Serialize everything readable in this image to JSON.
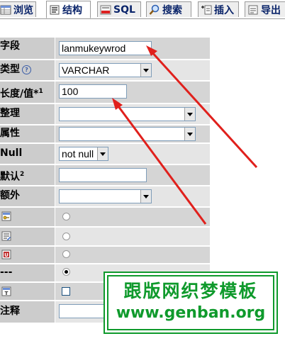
{
  "tabs": [
    {
      "label": "浏览",
      "icon": "browse-icon",
      "active": false
    },
    {
      "label": "结构",
      "icon": "structure-icon",
      "active": true
    },
    {
      "label": "SQL",
      "icon": "sql-icon",
      "active": false
    },
    {
      "label": "搜索",
      "icon": "search-icon",
      "active": false
    },
    {
      "label": "插入",
      "icon": "insert-icon",
      "active": false
    },
    {
      "label": "导出",
      "icon": "export-icon",
      "active": false
    }
  ],
  "form": {
    "field_label": "字段",
    "field_value": "lanmukeywrod",
    "type_label": "类型",
    "type_value": "VARCHAR",
    "length_label": "长度/值*",
    "length_sup": "1",
    "length_value": "100",
    "collation_label": "整理",
    "collation_value": "",
    "attributes_label": "属性",
    "attributes_value": "",
    "null_label": "Null",
    "null_value": "not null",
    "default_label": "默认",
    "default_sup": "2",
    "default_value": "",
    "extra_label": "额外",
    "extra_value": "",
    "option_dash_label": "---",
    "comment_label": "注释",
    "comment_value": ""
  },
  "index_options": {
    "primary_icon": "primary-key-icon",
    "index_icon": "index-icon",
    "unique_icon": "unique-icon",
    "fulltext_icon": "fulltext-icon",
    "selected": "none"
  },
  "watermark": {
    "line1": "跟版网织梦模板",
    "line2": "www.genban.org",
    "color": "#0f9a2c"
  },
  "colors": {
    "arrow": "#e0201c",
    "tab_text": "#0a246a"
  }
}
